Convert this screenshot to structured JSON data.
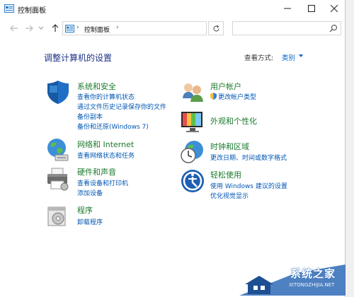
{
  "window": {
    "title": "控制面板"
  },
  "address_bar": {
    "separator": "›",
    "crumb": "控制面板",
    "separator2": "›"
  },
  "search": {
    "placeholder": ""
  },
  "content": {
    "heading": "调整计算机的设置",
    "view_by_label": "查看方式:",
    "view_by_value": "类别"
  },
  "categories": [
    {
      "title": "系统和安全",
      "links": [
        "查看你的计算机状态",
        "通过文件历史记录保存你的文件",
        "备份副本",
        "备份和还原(Windows 7)"
      ]
    },
    {
      "title": "网络和 Internet",
      "links": [
        "查看网络状态和任务"
      ]
    },
    {
      "title": "硬件和声音",
      "links": [
        "查看设备和打印机",
        "添加设备"
      ]
    },
    {
      "title": "程序",
      "links": [
        "卸载程序"
      ]
    },
    {
      "title": "用户帐户",
      "links": [
        "更改帐户类型"
      ]
    },
    {
      "title": "外观和个性化",
      "links": []
    },
    {
      "title": "时钟和区域",
      "links": [
        "更改日期、时间或数字格式"
      ]
    },
    {
      "title": "轻松使用",
      "links": [
        "使用 Windows 建议的设置",
        "优化视觉显示"
      ]
    }
  ],
  "watermark": {
    "text": "系统之家",
    "url": "XITONGZHIJIA.NET"
  },
  "colors": {
    "category_title": "#1a7a2c",
    "link": "#0056b3",
    "heading": "#1e3287"
  }
}
